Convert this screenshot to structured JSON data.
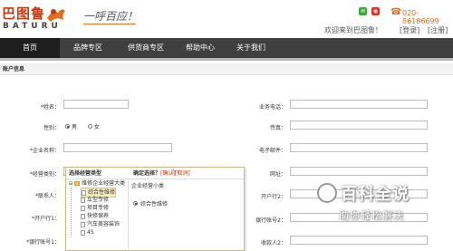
{
  "header": {
    "logo_text": "巴图鲁",
    "logo_sub": "BATURU",
    "slogan": "一呼百应！",
    "phone": "020-86186699",
    "welcome": "欢迎来到巴图鲁！",
    "login": "[登录]",
    "register": "[注册]"
  },
  "nav": {
    "items": [
      "首页",
      "品牌专区",
      "供货商专区",
      "帮助中心",
      "关于我们"
    ],
    "active": "首页"
  },
  "account": {
    "title": "账户信息"
  },
  "form": {
    "name": "*姓名：",
    "gender": "性别：",
    "gender_male": "男",
    "gender_female": "女",
    "company": "*企业名称：",
    "business": "*经营类别：",
    "contact": "*联系人：",
    "account1": "*开户行1：",
    "bank_account1": "*银行账号1：",
    "business_phone": "业务电话：",
    "fax": "传真：",
    "email": "电子邮件：",
    "website": "网址：",
    "account2": "开户行2：",
    "bank_account2": "银行账号2：",
    "receiver2": "收款人2："
  },
  "dropdown": {
    "header_left": "选择经营类型",
    "header_right": "确定选择？",
    "confirm": "[确认]",
    "cancel": "[取消]",
    "col2_title": "企业经营小类",
    "selected_value": "综合性维修",
    "tree": [
      "维修企业经营大类",
      "综合性维修",
      "车型专修",
      "项目专修",
      "快修保养",
      "汽车美容装饰",
      "4S"
    ]
  },
  "watermark": {
    "title": "百科全说",
    "subtitle": "助你轻松解决"
  },
  "colors": {
    "nav_bg": "#3f3f3f",
    "accent": "#e07020",
    "logo": "#c63a12"
  }
}
